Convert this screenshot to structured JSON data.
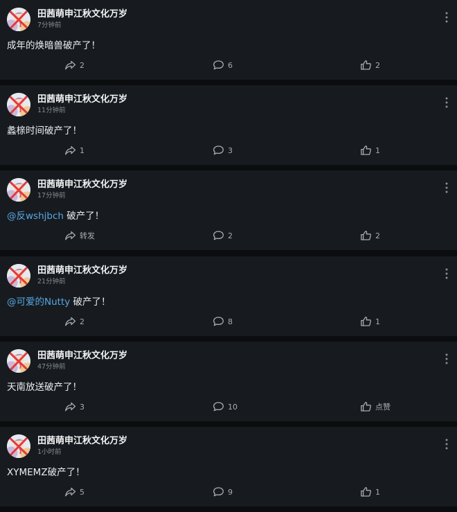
{
  "posts": [
    {
      "username": "田茜萌申江秋文化万岁",
      "time": "7分钟前",
      "mention": "",
      "text": "成年的焕暗兽破产了！",
      "share": "2",
      "comments": "6",
      "likes": "2"
    },
    {
      "username": "田茜萌申江秋文化万岁",
      "time": "11分钟前",
      "mention": "",
      "text": "蠡榇时间破产了！",
      "share": "1",
      "comments": "3",
      "likes": "1"
    },
    {
      "username": "田茜萌申江秋文化万岁",
      "time": "17分钟前",
      "mention": "@反wshjbch",
      "text": " 破产了！",
      "share": "转发",
      "comments": "2",
      "likes": "2"
    },
    {
      "username": "田茜萌申江秋文化万岁",
      "time": "21分钟前",
      "mention": "@可爱的Nutty",
      "text": " 破产了！",
      "share": "2",
      "comments": "8",
      "likes": "1"
    },
    {
      "username": "田茜萌申江秋文化万岁",
      "time": "47分钟前",
      "mention": "",
      "text": "天南放送破产了！",
      "share": "3",
      "comments": "10",
      "likes": "点赞"
    },
    {
      "username": "田茜萌申江秋文化万岁",
      "time": "1小时前",
      "mention": "",
      "text": "XYMEMZ破产了！",
      "share": "5",
      "comments": "9",
      "likes": "1"
    }
  ],
  "icons": {
    "share": "share-arrow-icon",
    "comment": "comment-bubble-icon",
    "like": "thumbs-up-icon",
    "more": "more-vertical-icon"
  },
  "colors": {
    "background": "#0b0d0e",
    "card": "#171b1f",
    "mention": "#57a8e6",
    "secondary_text": "#878d93"
  }
}
